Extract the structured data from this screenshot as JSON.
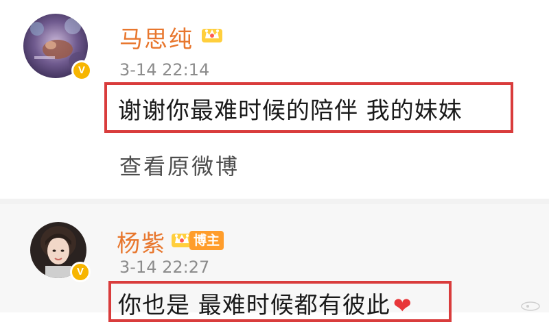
{
  "posts": [
    {
      "author": "马思纯",
      "time": "3-14 22:14",
      "content": "谢谢你最难时候的陪伴 我的妹妹",
      "action_label": "查看原微博",
      "crown_icon": "crown-icon",
      "verified_icon": "verified-v-icon",
      "accent_color": "#e8772e"
    },
    {
      "author": "杨紫",
      "time": "3-14 22:27",
      "badge": "博主",
      "content": "你也是 最难时候都有彼此",
      "emoji": "❤",
      "crown_icon": "crown-icon",
      "verified_icon": "verified-v-icon",
      "accent_color": "#e8772e"
    }
  ],
  "highlight_color": "#d93c3c"
}
